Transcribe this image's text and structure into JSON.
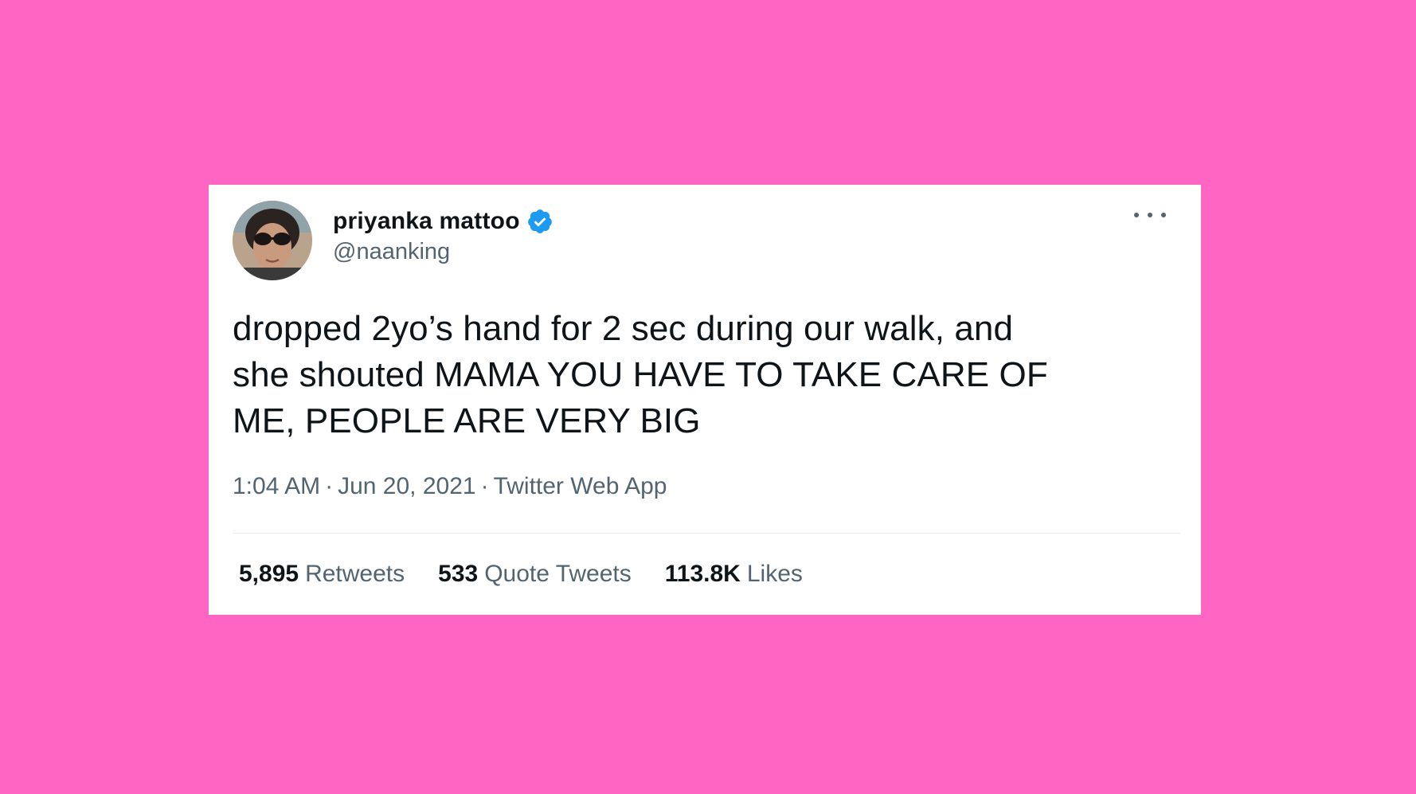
{
  "colors": {
    "background": "#ff66c4",
    "card": "#ffffff",
    "verified": "#1d9bf0",
    "text_primary": "#0f1419",
    "text_secondary": "#536471"
  },
  "tweet": {
    "author": {
      "display_name": "priyanka mattoo",
      "handle": "@naanking",
      "verified": true,
      "avatar_icon": "avatar-photo",
      "verified_icon": "verified-badge-icon"
    },
    "more_icon": "more-options-icon",
    "text": "dropped 2yo’s hand for 2 sec during our walk, and\nshe shouted MAMA YOU HAVE TO TAKE CARE OF\nME, PEOPLE ARE VERY BIG",
    "time": "1:04 AM",
    "date": "Jun 20, 2021",
    "separator": "·",
    "source": "Twitter Web App",
    "stats": [
      {
        "count": "5,895",
        "label": "Retweets"
      },
      {
        "count": "533",
        "label": "Quote Tweets"
      },
      {
        "count": "113.8K",
        "label": "Likes"
      }
    ]
  }
}
